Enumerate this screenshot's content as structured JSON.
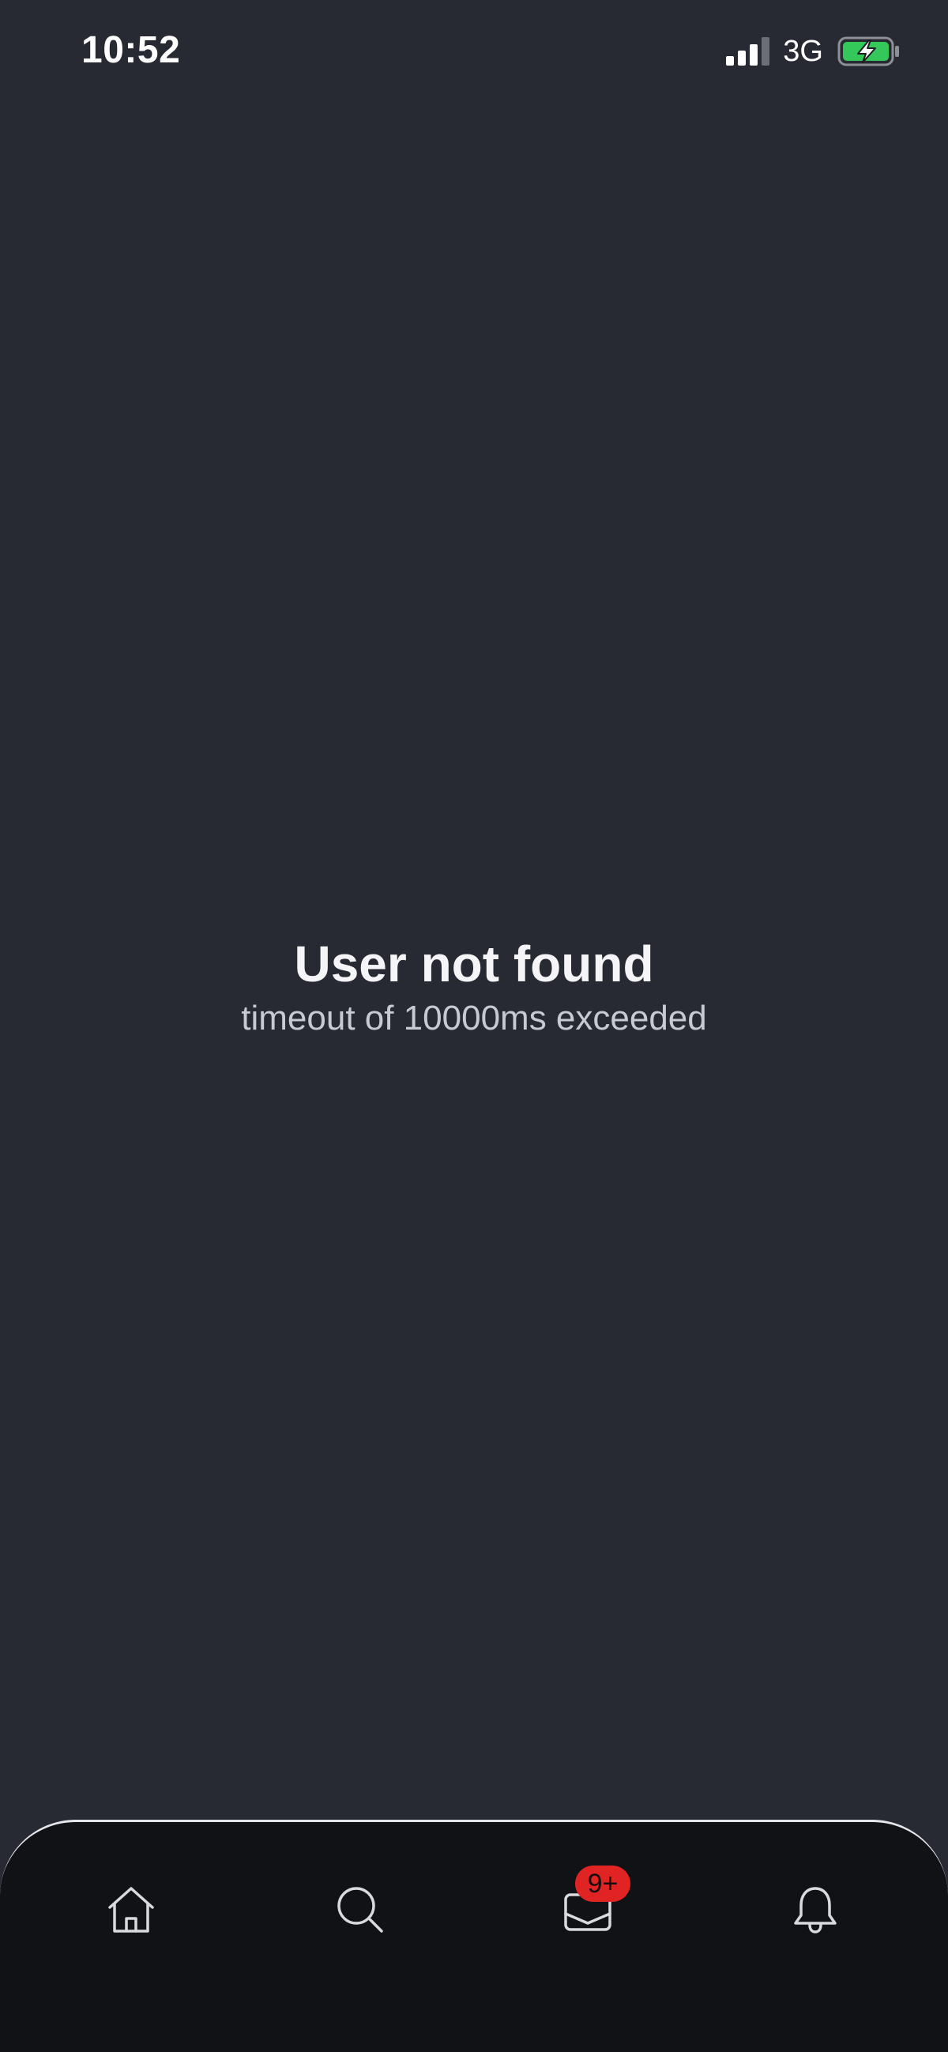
{
  "status_bar": {
    "time": "10:52",
    "network": "3G",
    "signal_icon": "signal-bars-icon",
    "battery_icon": "battery-charging-icon",
    "battery_color": "#34c759"
  },
  "message": {
    "title": "User not found",
    "subtitle": "timeout of 10000ms exceeded"
  },
  "tab_bar": {
    "tabs": [
      {
        "name": "home",
        "icon": "home-icon"
      },
      {
        "name": "search",
        "icon": "search-icon"
      },
      {
        "name": "inbox",
        "icon": "mail-icon"
      },
      {
        "name": "notifications",
        "icon": "bell-icon"
      }
    ],
    "inbox_badge": "9+",
    "badge_color": "#e02424"
  }
}
